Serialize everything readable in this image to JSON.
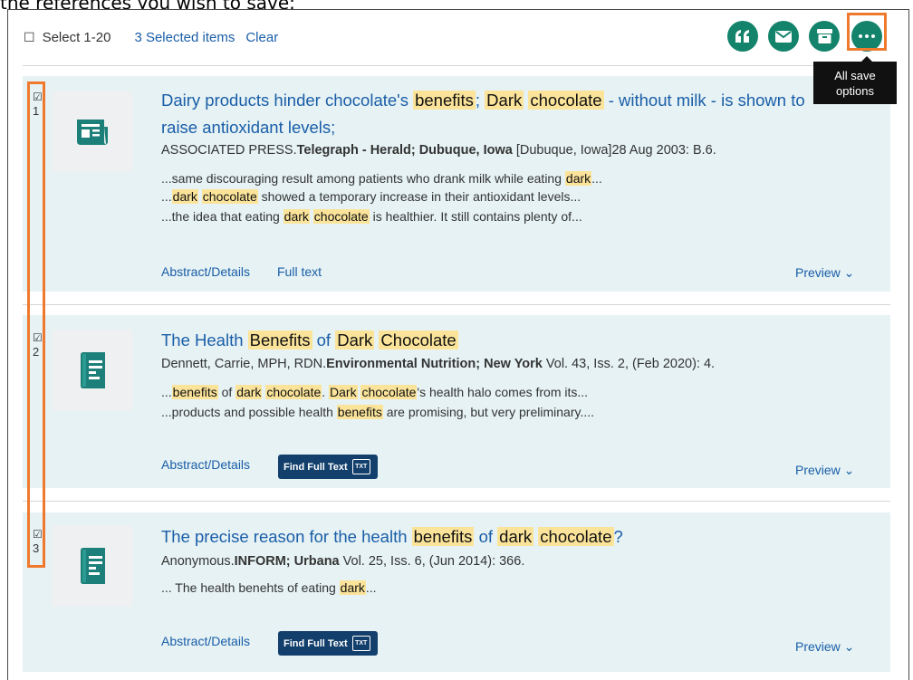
{
  "page": {
    "caption": "the references you wish to save:"
  },
  "toolbar": {
    "checkbox": "☐",
    "select_range": "Select 1-20",
    "selected_items": "3 Selected items",
    "clear": "Clear",
    "icons": [
      "cite-icon",
      "email-icon",
      "save-icon",
      "more-options-icon"
    ],
    "tooltip": [
      "All save",
      "options"
    ]
  },
  "results": [
    {
      "checked": "☑",
      "number": "1",
      "type_icon": "newspaper-icon",
      "title": [
        "Dairy products hinder chocolate's ",
        "benefits",
        "; ",
        "Dark",
        " ",
        "chocolate",
        " - without milk - is shown to"
      ],
      "title_line2": "raise antioxidant levels;",
      "meta": [
        "ASSOCIATED PRESS.",
        "Telegraph - Herald; Dubuque, Iowa",
        " [Dubuque, Iowa]28 Aug 2003: B.6."
      ],
      "snippets": [
        [
          "...same discouraging result among patients who drank milk while eating ",
          "dark",
          "..."
        ],
        [
          "...",
          "dark",
          " ",
          "chocolate",
          " showed a temporary increase in their antioxidant levels..."
        ],
        [
          "...the idea that eating ",
          "dark",
          " ",
          "chocolate",
          " is healthier. It still contains plenty of..."
        ]
      ],
      "links": [
        "Abstract/Details",
        "Full text"
      ],
      "preview": "Preview ⌄"
    },
    {
      "checked": "☑",
      "number": "2",
      "type_icon": "journal-icon",
      "title": [
        "The Health ",
        "Benefits",
        " of ",
        "Dark",
        " ",
        "Chocolate"
      ],
      "meta": [
        "Dennett, Carrie, MPH, RDN.",
        "Environmental Nutrition; New York",
        " Vol. 43, Iss. 2,  (Feb 2020): 4."
      ],
      "snippets": [
        [
          "...",
          "benefits",
          " of ",
          "dark",
          " ",
          "chocolate",
          ". ",
          "Dark",
          " ",
          "chocolate",
          "'s health halo comes from its..."
        ],
        [
          "...products and possible health ",
          "benefits",
          " are promising, but very preliminary...."
        ]
      ],
      "links": [
        "Abstract/Details"
      ],
      "find_full_text": "Find Full Text",
      "txt_badge": "TXT",
      "preview": "Preview ⌄"
    },
    {
      "checked": "☑",
      "number": "3",
      "type_icon": "journal-icon",
      "title": [
        "The precise reason for the health ",
        "benefits",
        " of ",
        "dark",
        " ",
        "chocolate",
        "?"
      ],
      "meta": [
        "Anonymous.",
        "INFORM; Urbana",
        " Vol. 25, Iss. 6,  (Jun 2014): 366."
      ],
      "snippets": [
        [
          "... The health benehts of eating ",
          "dark",
          "..."
        ]
      ],
      "links": [
        "Abstract/Details"
      ],
      "find_full_text": "Find Full Text",
      "txt_badge": "TXT",
      "preview": "Preview ⌄"
    }
  ],
  "colors": {
    "accent_green": "#13836b",
    "link_blue": "#1a5ea8",
    "highlight": "#fbe49a",
    "card_bg": "#e6f2f4",
    "annotation_orange": "#ef7a2e",
    "button_navy": "#123f6b"
  }
}
